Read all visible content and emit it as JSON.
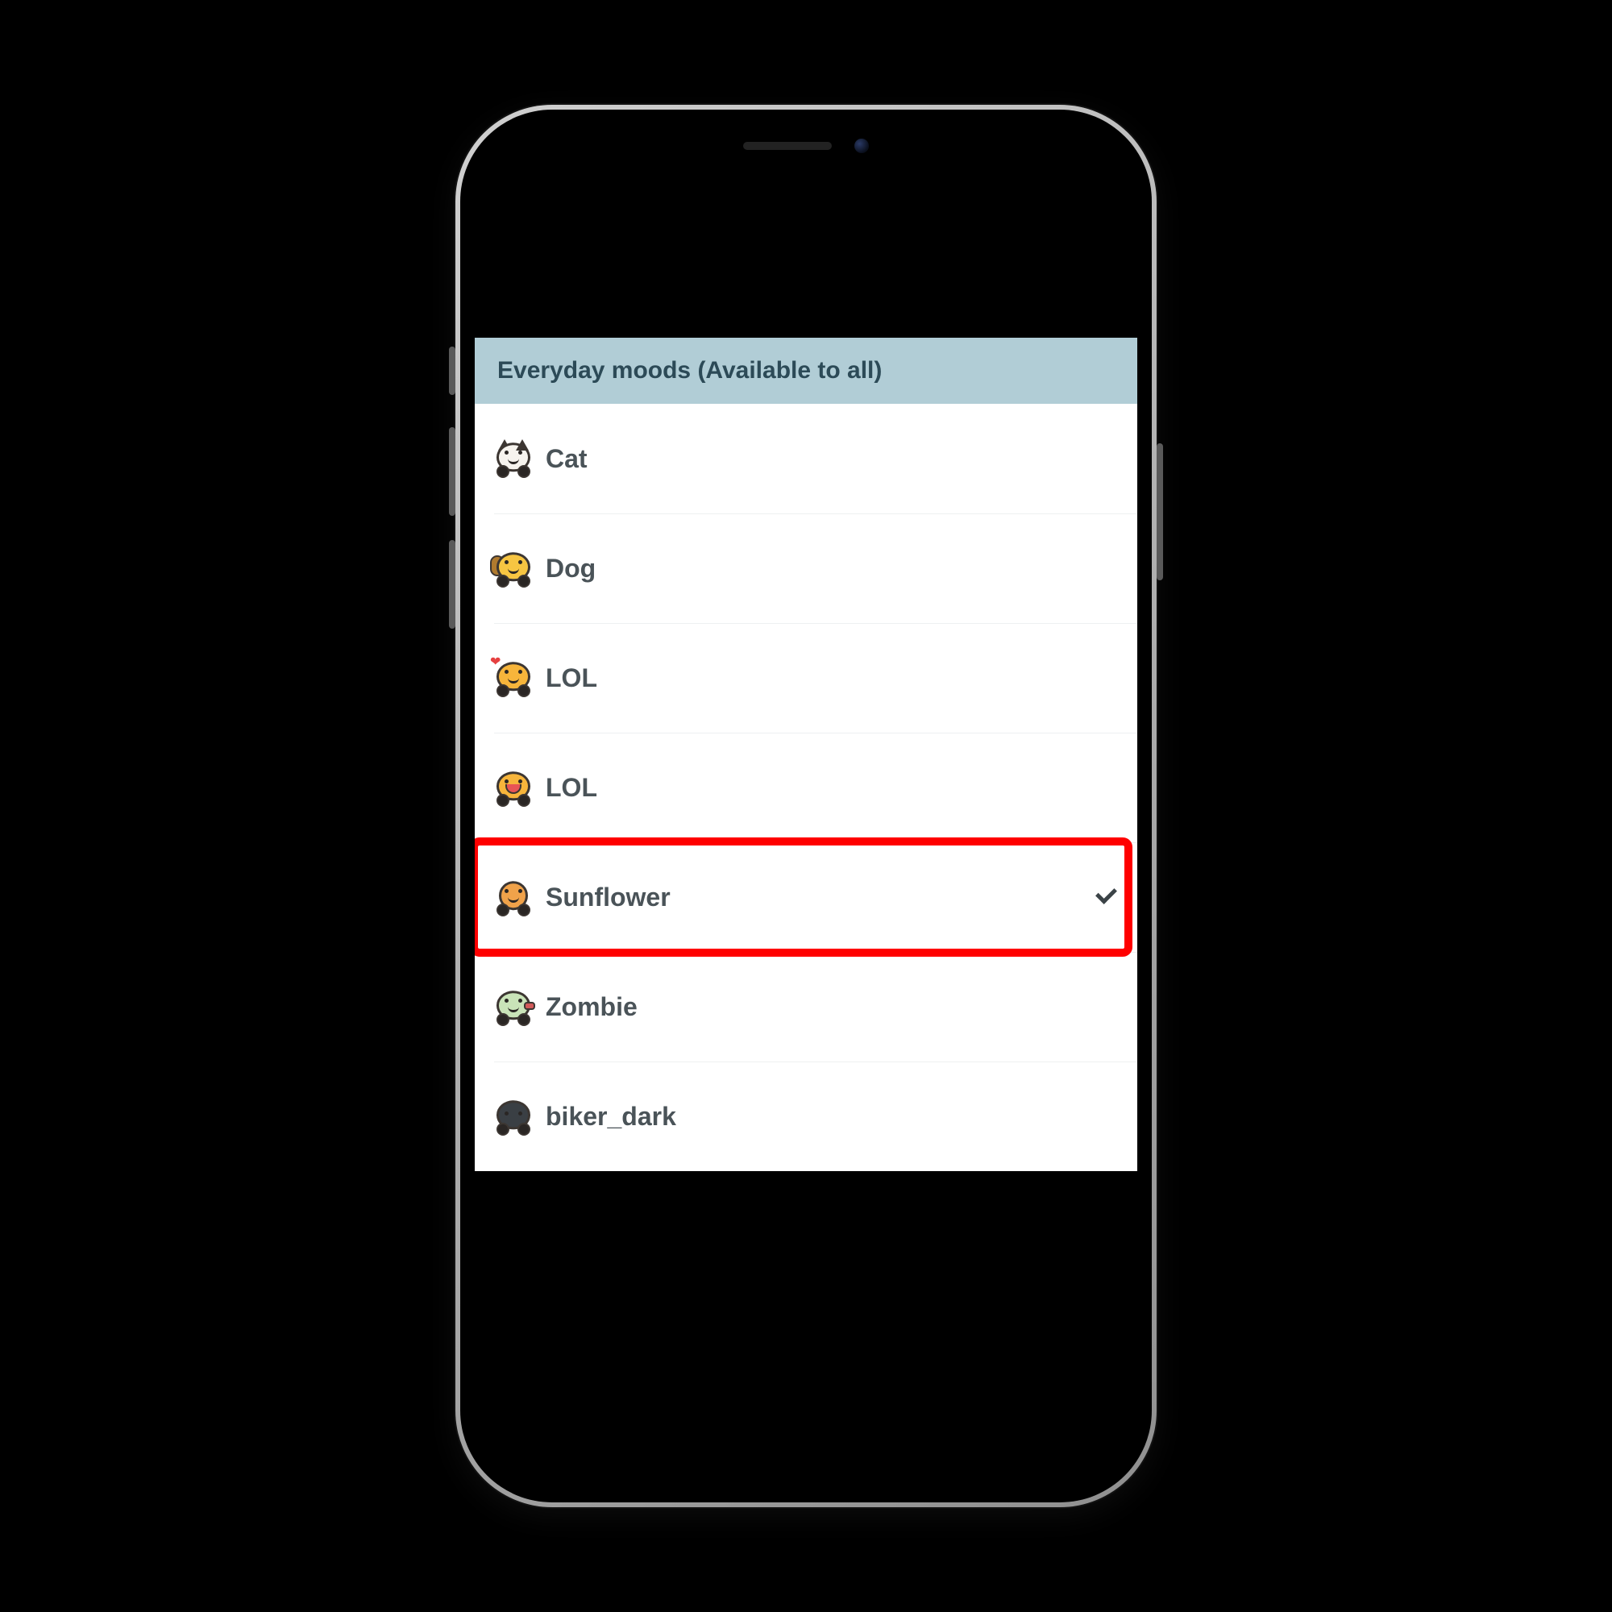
{
  "header": {
    "title": "Everyday moods (Available to all)"
  },
  "moods": [
    {
      "id": "cat",
      "label": "Cat",
      "icon": "cat-mood-icon",
      "selected": false,
      "highlighted": false
    },
    {
      "id": "dog",
      "label": "Dog",
      "icon": "dog-mood-icon",
      "selected": false,
      "highlighted": false
    },
    {
      "id": "lol1",
      "label": "LOL",
      "icon": "lol-love-mood-icon",
      "selected": false,
      "highlighted": false
    },
    {
      "id": "lol2",
      "label": "LOL",
      "icon": "lol-laugh-mood-icon",
      "selected": false,
      "highlighted": false
    },
    {
      "id": "sunflower",
      "label": "Sunflower",
      "icon": "sunflower-mood-icon",
      "selected": true,
      "highlighted": true
    },
    {
      "id": "zombie",
      "label": "Zombie",
      "icon": "zombie-mood-icon",
      "selected": false,
      "highlighted": false
    },
    {
      "id": "biker_dark",
      "label": "biker_dark",
      "icon": "biker-dark-mood-icon",
      "selected": false,
      "highlighted": false
    }
  ],
  "colors": {
    "header_bg": "#b1cdd6",
    "header_text": "#2c4a57",
    "label_text": "#4a5358",
    "highlight_border": "#ff0000",
    "divider": "#eef0f1"
  }
}
